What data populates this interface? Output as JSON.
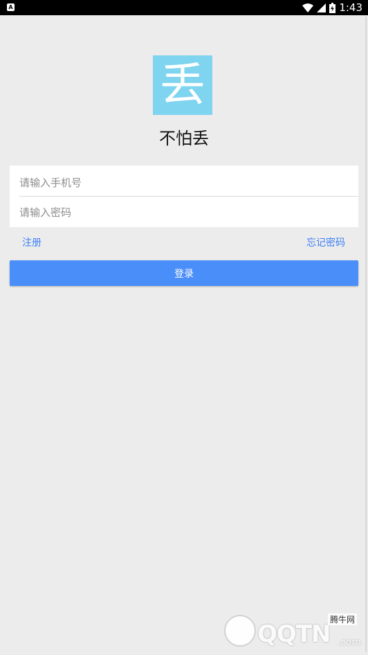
{
  "status_bar": {
    "time": "1:43",
    "left_icon_letter": "A",
    "icons": [
      "notification-a-icon",
      "wifi-icon",
      "signal-icon",
      "battery-icon"
    ]
  },
  "app": {
    "logo_glyph": "丢",
    "name": "不怕丢",
    "logo_color": "#7fd4ef"
  },
  "form": {
    "phone_placeholder": "请输入手机号",
    "password_placeholder": "请输入密码",
    "phone_value": "",
    "password_value": ""
  },
  "links": {
    "register": "注册",
    "forgot_password": "忘记密码"
  },
  "login_button": {
    "label": "登录",
    "color": "#4a8ef9"
  },
  "watermark": {
    "brand": "QQTN",
    "domain_suffix": ".com",
    "cn_name": "腾牛网"
  },
  "colors": {
    "background": "#ececec",
    "link": "#3b7ff5"
  }
}
